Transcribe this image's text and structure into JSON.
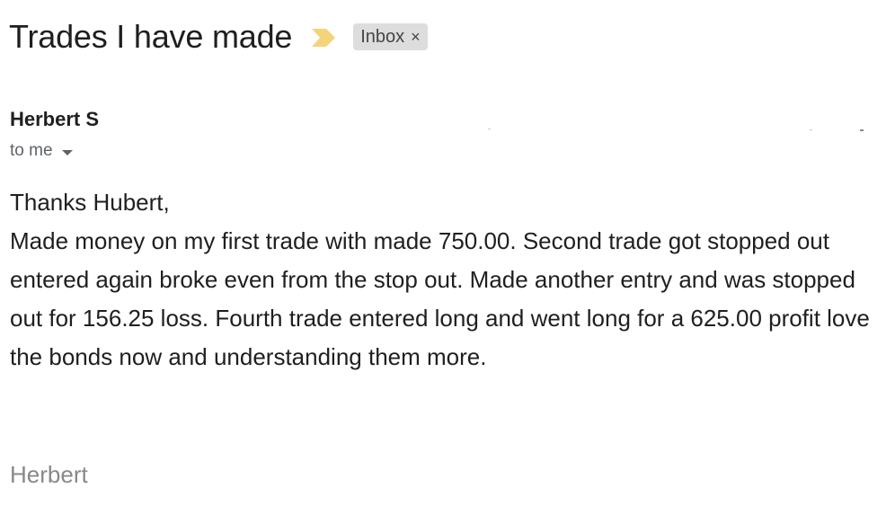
{
  "email": {
    "subject": "Trades I have made",
    "label": {
      "text": "Inbox",
      "remove_glyph": "×"
    },
    "importance_marker_icon": "importance-chevron-icon",
    "importance_marker_color": "#F4D47A",
    "sender": "Herbert S",
    "recipient_summary": "to me",
    "greeting": "Thanks Hubert,",
    "body": "Made money on my first trade with made 750.00. Second trade got stopped out entered again broke even from the stop out. Made another entry and was stopped out for 156.25 loss. Fourth trade entered long and went long for a 625.00 profit love the bonds now and understanding them more.",
    "signature": "Herbert"
  }
}
